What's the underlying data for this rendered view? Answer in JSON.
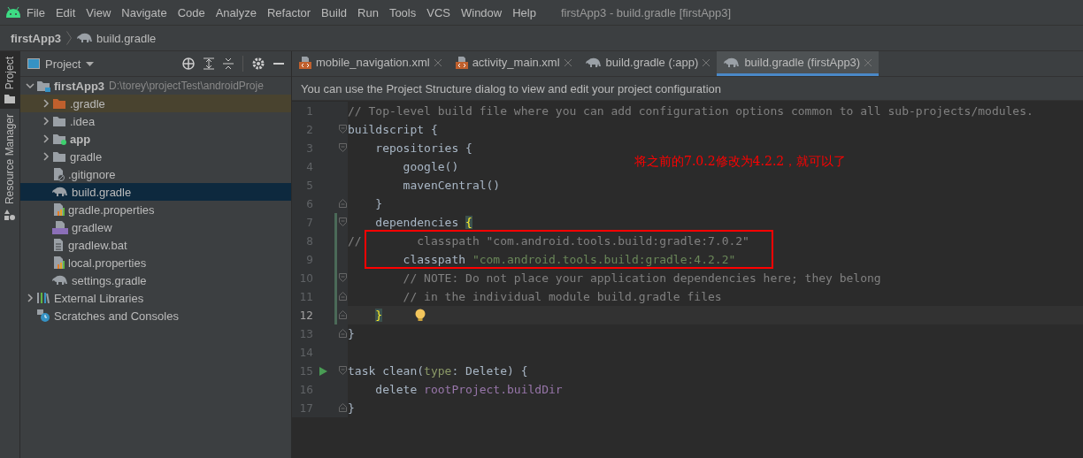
{
  "menu_bar": {
    "items": [
      "File",
      "Edit",
      "View",
      "Navigate",
      "Code",
      "Analyze",
      "Refactor",
      "Build",
      "Run",
      "Tools",
      "VCS",
      "Window",
      "Help"
    ],
    "window_title": "firstApp3 - build.gradle [firstApp3]"
  },
  "breadcrumb": [
    "firstApp3",
    "build.gradle"
  ],
  "side_stripe": [
    {
      "label": "Project",
      "selected": true
    },
    {
      "label": "Resource Manager",
      "selected": false
    }
  ],
  "project_panel": {
    "title": "Project",
    "tree": [
      {
        "label": "firstApp3",
        "path": "D:\\torey\\projectTest\\androidProje",
        "kind": "module",
        "expanded": true,
        "selected": false,
        "children": [
          {
            "label": ".gradle",
            "kind": "excluded-folder",
            "expanded": false,
            "selected": false
          },
          {
            "label": ".idea",
            "kind": "folder",
            "expanded": false,
            "selected": false
          },
          {
            "label": "app",
            "kind": "app-module",
            "expanded": false,
            "selected": false
          },
          {
            "label": "gradle",
            "kind": "folder",
            "expanded": false,
            "selected": false
          },
          {
            "label": ".gitignore",
            "kind": "ignore-file",
            "selected": false
          },
          {
            "label": "build.gradle",
            "kind": "gradle-file",
            "selected": true
          },
          {
            "label": "gradle.properties",
            "kind": "properties-file",
            "selected": false
          },
          {
            "label": "gradlew",
            "kind": "script-file",
            "selected": false
          },
          {
            "label": "gradlew.bat",
            "kind": "text-file",
            "selected": false
          },
          {
            "label": "local.properties",
            "kind": "properties-file",
            "selected": false
          },
          {
            "label": "settings.gradle",
            "kind": "gradle-file",
            "selected": false
          }
        ]
      },
      {
        "label": "External Libraries",
        "kind": "libraries",
        "expanded": false,
        "selected": false
      },
      {
        "label": "Scratches and Consoles",
        "kind": "scratches",
        "selected": false
      }
    ]
  },
  "tabs": [
    {
      "label": "mobile_navigation.xml",
      "kind": "xml",
      "selected": false
    },
    {
      "label": "activity_main.xml",
      "kind": "xml",
      "selected": false
    },
    {
      "label": "build.gradle (:app)",
      "kind": "gradle",
      "selected": false
    },
    {
      "label": "build.gradle (firstApp3)",
      "kind": "gradle",
      "selected": true
    }
  ],
  "notification": "You can use the Project Structure dialog to view and edit your project configuration",
  "editor": {
    "lines": [
      {
        "number": "1",
        "fold_open": false,
        "fold_close": false,
        "current": false,
        "changed": false,
        "bulb": false,
        "run": false,
        "segments": [
          {
            "kind": "comment",
            "text": "// Top-level build file where you can add configuration options common to all sub-projects/modules."
          }
        ]
      },
      {
        "number": "2",
        "fold_open": true,
        "fold_close": false,
        "current": false,
        "changed": false,
        "bulb": false,
        "run": false,
        "segments": [
          {
            "kind": "plain",
            "text": "buildscript {"
          }
        ]
      },
      {
        "number": "3",
        "fold_open": true,
        "fold_close": false,
        "current": false,
        "changed": false,
        "bulb": false,
        "run": false,
        "segments": [
          {
            "kind": "plain",
            "text": "    repositories {"
          }
        ]
      },
      {
        "number": "4",
        "fold_open": false,
        "fold_close": false,
        "current": false,
        "changed": false,
        "bulb": false,
        "run": false,
        "segments": [
          {
            "kind": "plain",
            "text": "        google()"
          }
        ]
      },
      {
        "number": "5",
        "fold_open": false,
        "fold_close": false,
        "current": false,
        "changed": false,
        "bulb": false,
        "run": false,
        "segments": [
          {
            "kind": "plain",
            "text": "        mavenCentral()"
          }
        ]
      },
      {
        "number": "6",
        "fold_open": false,
        "fold_close": true,
        "current": false,
        "changed": false,
        "bulb": false,
        "run": false,
        "segments": [
          {
            "kind": "plain",
            "text": "    }"
          }
        ]
      },
      {
        "number": "7",
        "fold_open": true,
        "fold_close": false,
        "current": false,
        "changed": true,
        "bulb": false,
        "run": false,
        "segments": [
          {
            "kind": "plain",
            "text": "    dependencies "
          },
          {
            "kind": "brace-match",
            "text": "{"
          }
        ]
      },
      {
        "number": "8",
        "fold_open": false,
        "fold_close": false,
        "current": false,
        "changed": true,
        "bulb": false,
        "run": false,
        "segments": [
          {
            "kind": "comment",
            "text": "//        classpath \"com.android.tools.build:gradle:7.0.2\""
          }
        ]
      },
      {
        "number": "9",
        "fold_open": false,
        "fold_close": false,
        "current": false,
        "changed": true,
        "bulb": false,
        "run": false,
        "segments": [
          {
            "kind": "plain",
            "text": "        classpath "
          },
          {
            "kind": "string",
            "text": "\"com.android.tools.build:gradle:4.2.2\""
          }
        ]
      },
      {
        "number": "10",
        "fold_open": true,
        "fold_close": false,
        "current": false,
        "changed": true,
        "bulb": false,
        "run": false,
        "segments": [
          {
            "kind": "comment",
            "text": "        // NOTE: Do not place your application dependencies here; they belong"
          }
        ]
      },
      {
        "number": "11",
        "fold_open": false,
        "fold_close": true,
        "current": false,
        "changed": true,
        "bulb": false,
        "run": false,
        "segments": [
          {
            "kind": "comment",
            "text": "        // in the individual module build.gradle files"
          }
        ]
      },
      {
        "number": "12",
        "fold_open": false,
        "fold_close": true,
        "current": true,
        "changed": true,
        "bulb": true,
        "run": false,
        "segments": [
          {
            "kind": "brace-match",
            "text": "    }"
          }
        ]
      },
      {
        "number": "13",
        "fold_open": false,
        "fold_close": true,
        "current": false,
        "changed": false,
        "bulb": false,
        "run": false,
        "segments": [
          {
            "kind": "plain",
            "text": "}"
          }
        ]
      },
      {
        "number": "14",
        "fold_open": false,
        "fold_close": false,
        "current": false,
        "changed": false,
        "bulb": false,
        "run": false
      },
      {
        "number": "15",
        "fold_open": true,
        "fold_close": false,
        "current": false,
        "changed": false,
        "bulb": false,
        "run": true,
        "segments": [
          {
            "kind": "plain",
            "text": "task clean("
          },
          {
            "kind": "param",
            "text": "type"
          },
          {
            "kind": "plain",
            "text": ": Delete) {"
          }
        ]
      },
      {
        "number": "16",
        "fold_open": false,
        "fold_close": false,
        "current": false,
        "changed": false,
        "bulb": false,
        "run": false,
        "segments": [
          {
            "kind": "plain",
            "text": "    delete "
          },
          {
            "kind": "property",
            "text": "rootProject.buildDir"
          }
        ]
      },
      {
        "number": "17",
        "fold_open": false,
        "fold_close": true,
        "current": false,
        "changed": false,
        "bulb": false,
        "run": false,
        "segments": [
          {
            "kind": "plain",
            "text": "}"
          }
        ]
      }
    ]
  },
  "annotation": {
    "text": "将之前的7.0.2修改为4.2.2，就可以了"
  }
}
